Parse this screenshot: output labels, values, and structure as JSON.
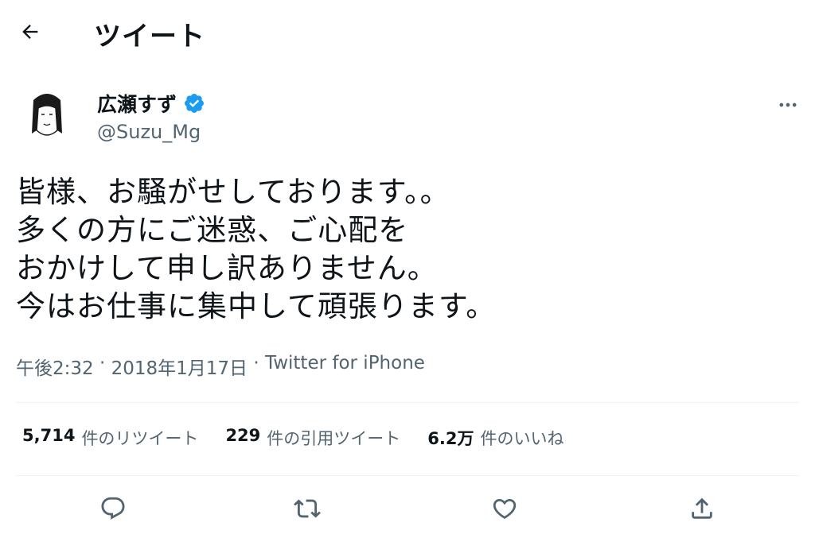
{
  "header": {
    "back_icon": "arrow-left-icon",
    "title": "ツイート"
  },
  "author": {
    "display_name": "広瀬すず",
    "handle": "@Suzu_Mg",
    "verified_icon": "verified-badge-icon",
    "more_icon": "more-horizontal-icon"
  },
  "tweet": {
    "text": "皆様、お騒がせしております。。\n多くの方にご迷惑、ご心配を\nおかけして申し訳ありません。\n今はお仕事に集中して頑張ります。",
    "time": "午後2:32",
    "separator": " · ",
    "date": "2018年1月17日",
    "source": "Twitter for iPhone"
  },
  "stats": [
    {
      "count": "5,714",
      "label": "件のリツイート"
    },
    {
      "count": "229",
      "label": "件の引用ツイート"
    },
    {
      "count": "6.2万",
      "label": "件のいいね"
    }
  ],
  "actions": [
    {
      "icon": "reply-icon"
    },
    {
      "icon": "retweet-icon"
    },
    {
      "icon": "like-icon"
    },
    {
      "icon": "share-icon"
    }
  ],
  "colors": {
    "text": "#0f1419",
    "secondary": "#536471",
    "verified": "#1d9bf0",
    "divider": "#eff3f4"
  }
}
